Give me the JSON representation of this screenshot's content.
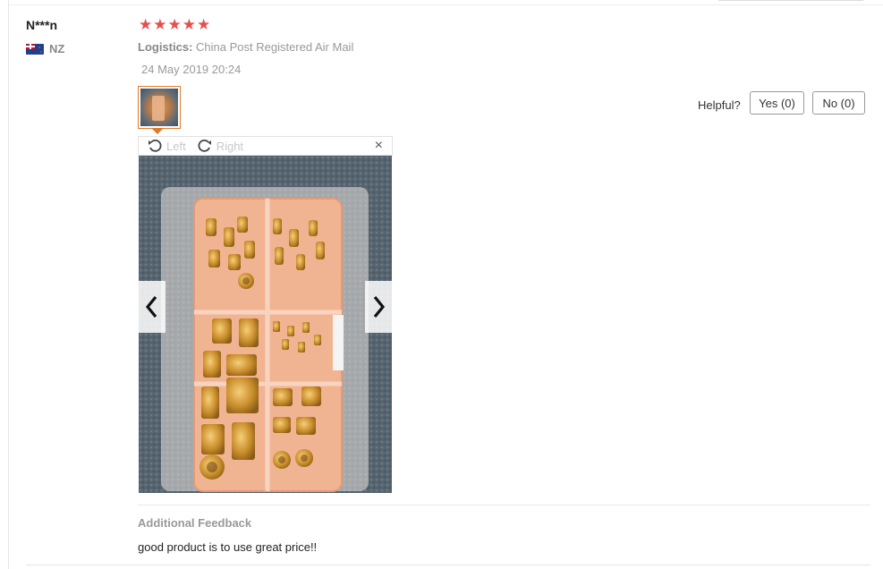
{
  "review": {
    "user": "N***n",
    "country_code": "NZ",
    "stars": [
      "★",
      "★",
      "★",
      "★",
      "★"
    ],
    "logistics_label": "Logistics:",
    "logistics_value": "China Post Registered Air Mail",
    "date": "24 May 2019 20:24",
    "helpful_label": "Helpful?",
    "yes_label": "Yes (0)",
    "no_label": "No (0)"
  },
  "viewer": {
    "rotate_left_label": "Left",
    "rotate_right_label": "Right",
    "close_label": "×"
  },
  "feedback": {
    "title": "Additional Feedback",
    "text": "good product is to use great price!!"
  },
  "colors": {
    "star": "#e3504f",
    "thumb_border": "#e07a2a"
  }
}
